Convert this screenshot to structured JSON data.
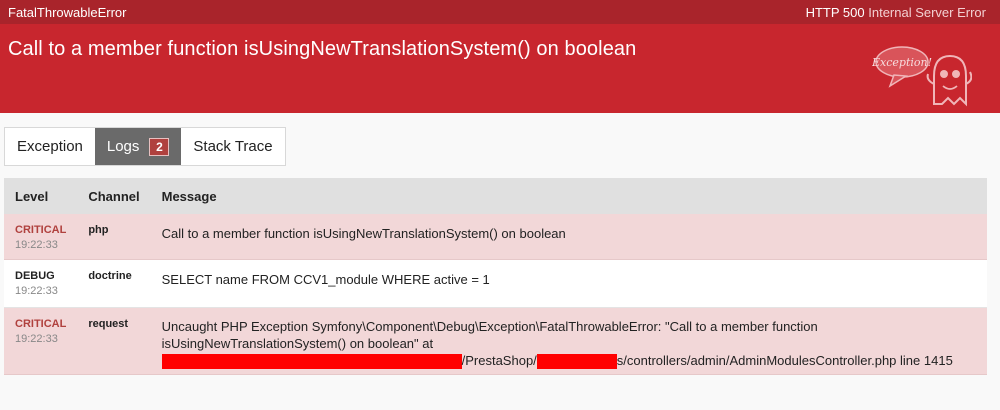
{
  "topbar": {
    "exception_class": "FatalThrowableError",
    "status_code": "HTTP 500",
    "status_text": "Internal Server Error"
  },
  "header": {
    "title": "Call to a member function isUsingNewTranslationSystem() on boolean",
    "mascot_text": "Exception!"
  },
  "tabs": [
    {
      "label": "Exception"
    },
    {
      "label": "Logs",
      "badge": "2"
    },
    {
      "label": "Stack Trace"
    }
  ],
  "logs": {
    "columns": [
      "Level",
      "Channel",
      "Message"
    ],
    "rows": [
      {
        "level": "CRITICAL",
        "time": "19:22:33",
        "channel": "php",
        "message": "Call to a member function isUsingNewTranslationSystem() on boolean"
      },
      {
        "level": "DEBUG",
        "time": "19:22:33",
        "channel": "doctrine",
        "message": "SELECT name FROM CCV1_module WHERE active = 1"
      },
      {
        "level": "CRITICAL",
        "time": "19:22:33",
        "channel": "request",
        "message_line1": "Uncaught PHP Exception Symfony\\Component\\Debug\\Exception\\FatalThrowableError: \"Call to a member function",
        "message_line2": "isUsingNewTranslationSystem() on boolean\" at",
        "message_line3_mid": "/PrestaShop/",
        "message_line3_end": "s/controllers/admin/AdminModulesController.php line 1415"
      }
    ]
  },
  "colors": {
    "topbar": "#a9242b",
    "header": "#c8262e",
    "critical_row": "#f2d7d8",
    "critical_text": "#b0413e",
    "redaction": "#ff0000"
  }
}
